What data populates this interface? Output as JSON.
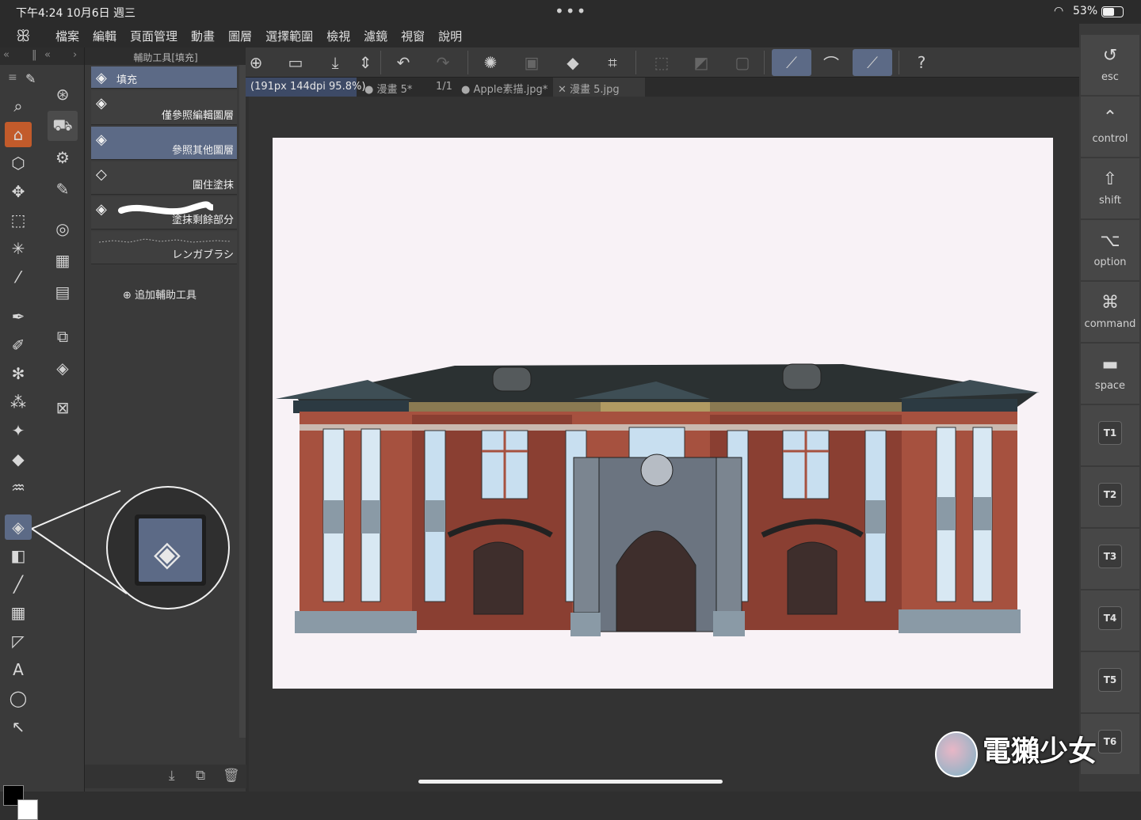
{
  "status": {
    "time": "下午4:24   10月6日 週三",
    "dots": "•••",
    "battery": "53%",
    "battery_level": 0.53
  },
  "menu": [
    "檔案",
    "編輯",
    "頁面管理",
    "動畫",
    "圖層",
    "選擇範圍",
    "檢視",
    "濾鏡",
    "視窗",
    "說明"
  ],
  "subtool_panel": {
    "title": "輔助工具[填充]",
    "items": [
      {
        "label": "填充"
      },
      {
        "label": "僅參照編輯圖層"
      },
      {
        "label": "參照其他圖層"
      },
      {
        "label": "圍住塗抹"
      },
      {
        "label": "塗抹剩餘部分"
      },
      {
        "label": "レンガブラシ"
      }
    ],
    "add_label": "追加輔助工具"
  },
  "tabs": [
    {
      "label": "(191px 144dpi 95.8%)"
    },
    {
      "label": "● 漫畫 5*"
    },
    {
      "label": "1/1"
    },
    {
      "label": "● Apple素描.jpg*"
    },
    {
      "label": "✕ 漫畫 5.jpg"
    }
  ],
  "keys": [
    {
      "icon": "↺",
      "label": "esc"
    },
    {
      "icon": "⌃",
      "label": "control"
    },
    {
      "icon": "⇧",
      "label": "shift"
    },
    {
      "icon": "⌥",
      "label": "option"
    },
    {
      "icon": "⌘",
      "label": "command"
    },
    {
      "icon": "▬",
      "label": "space"
    }
  ],
  "touch_keys": [
    "T1",
    "T2",
    "T3",
    "T4",
    "T5",
    "T6"
  ],
  "watermark": "電獺少女",
  "colors": {
    "foreground": "#000000",
    "background": "#ffffff",
    "accent": "#5c6a86"
  }
}
